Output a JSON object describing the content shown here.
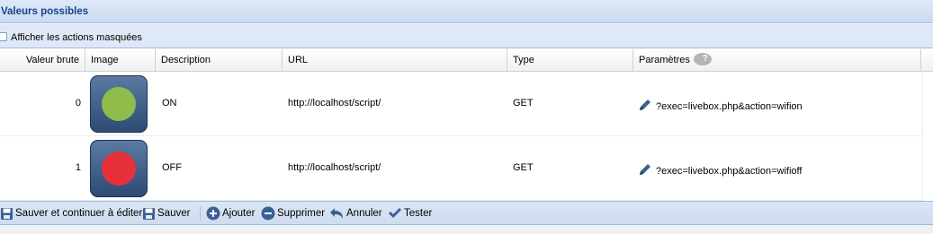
{
  "panel": {
    "title": "Valeurs possibles"
  },
  "options": {
    "show_hidden_label": "Afficher les actions masquées",
    "show_hidden_checked": false
  },
  "grid": {
    "columns": [
      {
        "label": "Valeur brute"
      },
      {
        "label": "Image"
      },
      {
        "label": "Description"
      },
      {
        "label": "URL"
      },
      {
        "label": "Type"
      },
      {
        "label": "Paramètres"
      }
    ],
    "help_glyph": "?",
    "rows": [
      {
        "value": "0",
        "image_icon": "green-circle-icon",
        "image_color": "#8fbc4a",
        "description": "ON",
        "url": "http://localhost/script/",
        "type": "GET",
        "params": "?exec=livebox.php&action=wifion"
      },
      {
        "value": "1",
        "image_icon": "red-circle-icon",
        "image_color": "#e8303a",
        "description": "OFF",
        "url": "http://localhost/script/",
        "type": "GET",
        "params": "?exec=livebox.php&action=wifioff"
      }
    ]
  },
  "toolbar": {
    "save_continue_label": "Sauver et continuer à éditer",
    "save_label": "Sauver",
    "add_label": "Ajouter",
    "delete_label": "Supprimer",
    "cancel_label": "Annuler",
    "test_label": "Tester"
  },
  "colors": {
    "header_text": "#15428b",
    "panel_bg": "#dfe8f6",
    "border": "#99bbe8",
    "icon_blue": "#3a5f93"
  }
}
